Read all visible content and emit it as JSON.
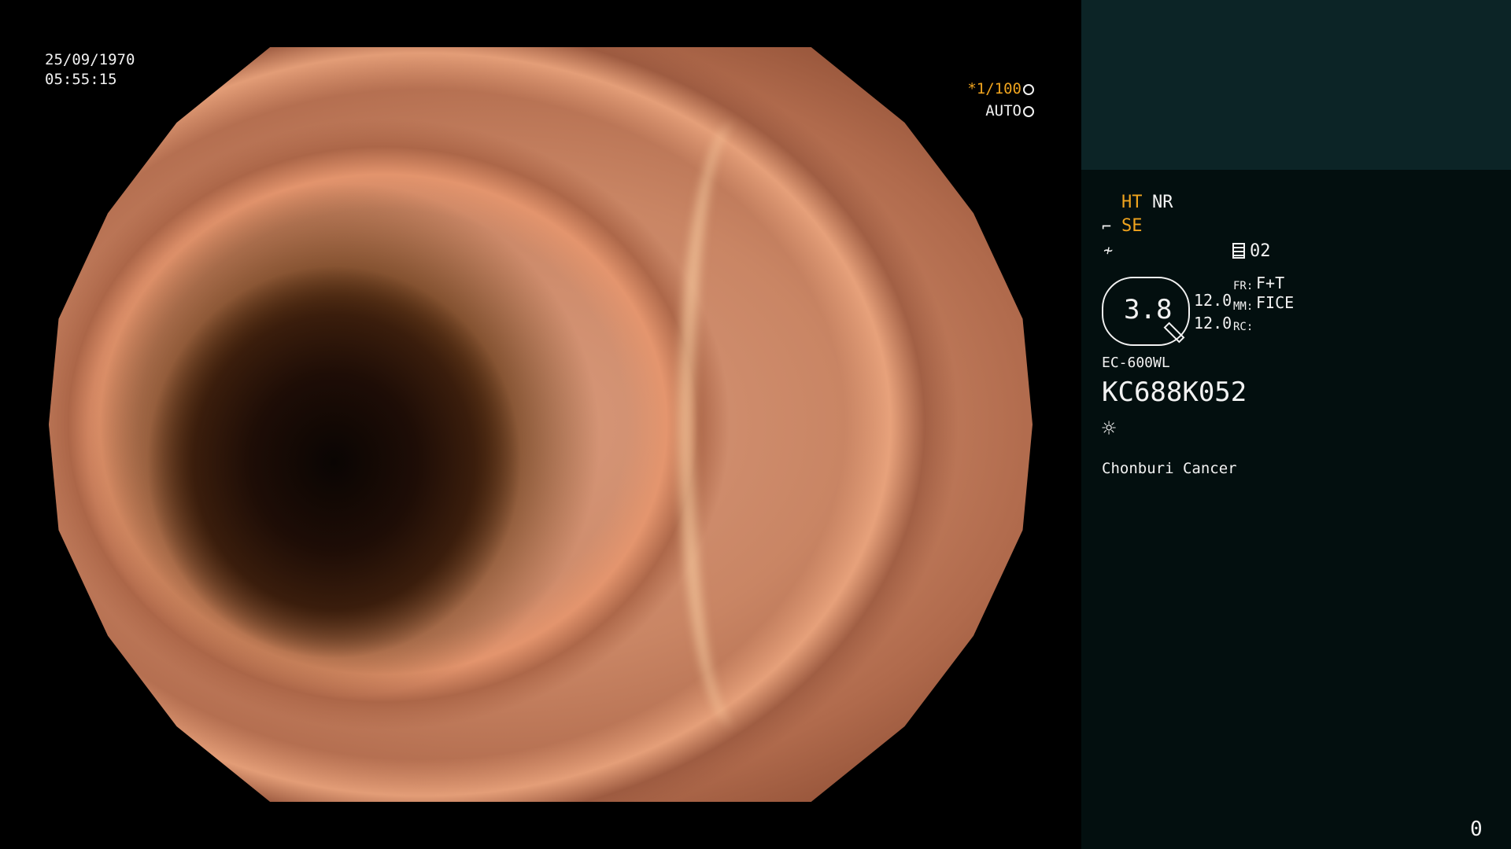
{
  "overlay": {
    "date": "25/09/1970",
    "time": "05:55:15",
    "shutter": "*1/100",
    "mode": "AUTO"
  },
  "panel": {
    "ht": "HT",
    "nr": "NR",
    "se": "SE",
    "prog_num": "02",
    "zoom": "3.8",
    "val1": "12.0",
    "val2": "12.0",
    "fr_label": "FR:",
    "fr_value": "F+T",
    "mm_label": "MM:",
    "mm_value": "FICE",
    "rc_label": "RC:",
    "scope_model": "EC-600WL",
    "serial": "KC688K052",
    "institution": "Chonburi Cancer",
    "counter": "0"
  },
  "colors": {
    "accent": "#f0a41e",
    "panel_top": "#0c2426",
    "panel": "#030f0f"
  },
  "icons": [
    "shutter-icon",
    "auto-icon",
    "scope-icon",
    "freeze-icon",
    "document-icon",
    "brightness-icon"
  ]
}
